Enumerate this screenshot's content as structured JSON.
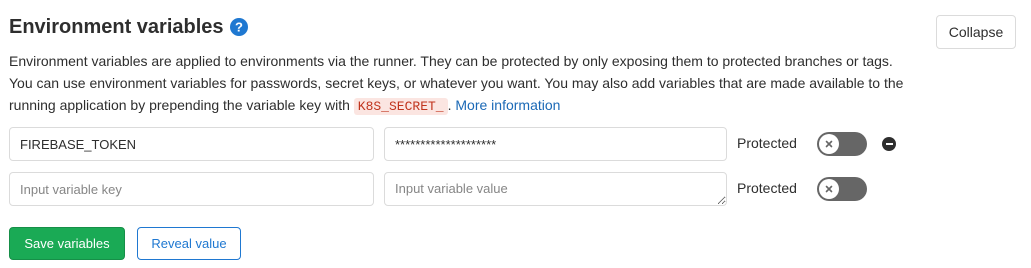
{
  "header": {
    "title": "Environment variables",
    "help_icon": "question-circle-icon",
    "collapse_label": "Collapse"
  },
  "description": {
    "text_before_code": "Environment variables are applied to environments via the runner. They can be protected by only exposing them to protected branches or tags. You can use environment variables for passwords, secret keys, or whatever you want. You may also add variables that are made available to the running application by prepending the variable key with ",
    "code": "K8S_SECRET_",
    "text_after_code": ". ",
    "link_label": "More information"
  },
  "variables": [
    {
      "key": "FIREBASE_TOKEN",
      "value": "********************",
      "protected_label": "Protected",
      "protected": false,
      "remove_icon": "remove-circle-icon"
    },
    {
      "key": "",
      "key_placeholder": "Input variable key",
      "value": "",
      "value_placeholder": "Input variable value",
      "protected_label": "Protected",
      "protected": false
    }
  ],
  "actions": {
    "save_label": "Save variables",
    "reveal_label": "Reveal value"
  },
  "colors": {
    "primary_green": "#1aaa55",
    "link_blue": "#1f78d1",
    "code_red": "#c0341d",
    "toggle_off": "#666666"
  }
}
